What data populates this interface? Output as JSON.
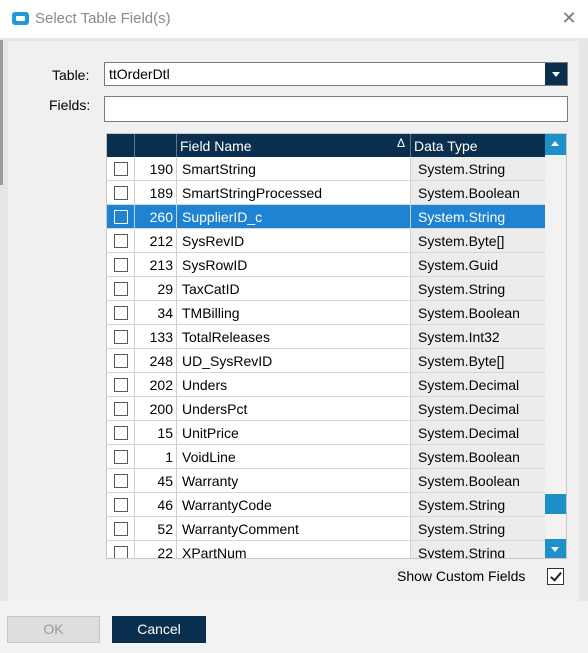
{
  "window": {
    "title": "Select Table Field(s)",
    "icon": "app-window-icon",
    "close_icon": "close-icon"
  },
  "form": {
    "table_label": "Table:",
    "table_value": "ttOrderDtl",
    "fields_label": "Fields:",
    "fields_value": ""
  },
  "grid": {
    "columns": [
      "",
      "",
      "Field Name",
      "Data Type"
    ],
    "sort_indicator": "Δ",
    "selected_row_index": 2,
    "rows": [
      {
        "num": "190",
        "name": "SmartString",
        "type": "System.String"
      },
      {
        "num": "189",
        "name": "SmartStringProcessed",
        "type": "System.Boolean"
      },
      {
        "num": "260",
        "name": "SupplierID_c",
        "type": "System.String"
      },
      {
        "num": "212",
        "name": "SysRevID",
        "type": "System.Byte[]"
      },
      {
        "num": "213",
        "name": "SysRowID",
        "type": "System.Guid"
      },
      {
        "num": "29",
        "name": "TaxCatID",
        "type": "System.String"
      },
      {
        "num": "34",
        "name": "TMBilling",
        "type": "System.Boolean"
      },
      {
        "num": "133",
        "name": "TotalReleases",
        "type": "System.Int32"
      },
      {
        "num": "248",
        "name": "UD_SysRevID",
        "type": "System.Byte[]"
      },
      {
        "num": "202",
        "name": "Unders",
        "type": "System.Decimal"
      },
      {
        "num": "200",
        "name": "UndersPct",
        "type": "System.Decimal"
      },
      {
        "num": "15",
        "name": "UnitPrice",
        "type": "System.Decimal"
      },
      {
        "num": "1",
        "name": "VoidLine",
        "type": "System.Boolean"
      },
      {
        "num": "45",
        "name": "Warranty",
        "type": "System.Boolean"
      },
      {
        "num": "46",
        "name": "WarrantyCode",
        "type": "System.String"
      },
      {
        "num": "52",
        "name": "WarrantyComment",
        "type": "System.String"
      },
      {
        "num": "22",
        "name": "XPartNum",
        "type": "System.String"
      }
    ],
    "scroll_position": 0.93
  },
  "options": {
    "show_custom_label": "Show Custom Fields",
    "show_custom_checked": true
  },
  "buttons": {
    "ok": "OK",
    "cancel": "Cancel"
  },
  "colors": {
    "accent_dark": "#0a2f4e",
    "selection": "#1e83d2",
    "scroll_accent": "#1e90c8"
  }
}
